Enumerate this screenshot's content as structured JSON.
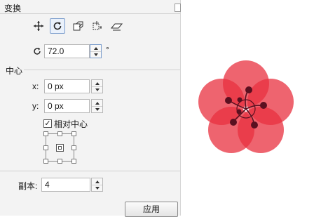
{
  "panel": {
    "title": "变换",
    "toolbar": [
      "position-icon",
      "rotate-icon",
      "scale-icon",
      "size-icon",
      "skew-icon"
    ],
    "active_tool": "rotate-icon"
  },
  "rotation": {
    "value": "72.0",
    "unit": "°",
    "icon": "rotate-icon"
  },
  "center": {
    "heading": "中心",
    "x_label": "x:",
    "x_value": "0 px",
    "y_label": "y:",
    "y_value": "0 px",
    "relative_label": "相对中心",
    "relative_checked": true,
    "checkmark": "✓"
  },
  "copies": {
    "label": "副本:",
    "value": "4"
  },
  "apply_label": "应用",
  "colors": {
    "petal": "#e8303f",
    "stamen": "#5a1020",
    "panel_bg": "#f3f3f3",
    "accent": "#7a9ccc"
  }
}
